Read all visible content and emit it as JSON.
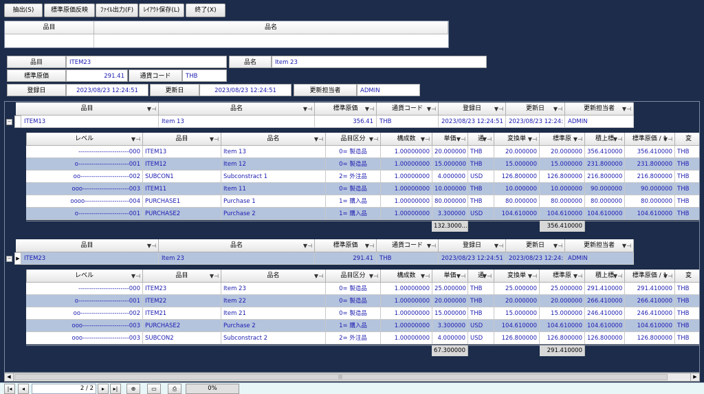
{
  "toolbar": {
    "extract": "抽出(S)",
    "std_cost_reflect": "標準原価反映",
    "file_output": "ﾌｧｲﾙ出力(F)",
    "layout_save": "ﾚｲｱｳﾄ保存(L)",
    "exit": "終了(X)"
  },
  "search": {
    "item_label": "品目",
    "name_label": "品名",
    "item_value": "",
    "name_value": ""
  },
  "info": {
    "item_label": "品目",
    "item_value": "ITEM23",
    "name_label": "品名",
    "name_value": "Item 23",
    "std_cost_label": "標準原価",
    "std_cost_value": "291.41",
    "currency_label": "通貨コード",
    "currency_value": "THB",
    "reg_date_label": "登録日",
    "reg_date_value": "2023/08/23 12:24:51",
    "upd_date_label": "更新日",
    "upd_date_value": "2023/08/23 12:24:51",
    "updater_label": "更新担当者",
    "updater_value": "ADMIN"
  },
  "parent_headers": [
    "品目",
    "品名",
    "標準原価",
    "通貨コード",
    "登録日",
    "更新日",
    "更新担当者"
  ],
  "child_headers": [
    "レベル",
    "品目",
    "品名",
    "品目区分",
    "構成数",
    "単価",
    "通",
    "変換単",
    "標準原",
    "積上標",
    "標準原価 / 1",
    "変"
  ],
  "groups": [
    {
      "parent": [
        "ITEM13",
        "Item 13",
        "356.41",
        "THB",
        "2023/08/23 12:24:51",
        "2023/08/23 12:24:",
        "ADMIN"
      ],
      "current": false,
      "rows": [
        [
          "------------------------000",
          "ITEM13",
          "Item 13",
          "0= 製造品",
          "1.00000000",
          "20.000000",
          "THB",
          "20.000000",
          "20.000000",
          "356.410000",
          "356.410000",
          "THB"
        ],
        [
          "o------------------------001",
          "ITEM12",
          "Item 12",
          "0= 製造品",
          "1.00000000",
          "15.000000",
          "THB",
          "15.000000",
          "15.000000",
          "231.800000",
          "231.800000",
          "THB"
        ],
        [
          "oo-----------------------002",
          "SUBCON1",
          "Subconstract 1",
          "2= 外注品",
          "1.00000000",
          "4.000000",
          "USD",
          "126.800000",
          "126.800000",
          "216.800000",
          "216.800000",
          "THB"
        ],
        [
          "ooo----------------------003",
          "ITEM11",
          "Item 11",
          "0= 製造品",
          "1.00000000",
          "10.000000",
          "THB",
          "10.000000",
          "10.000000",
          "90.000000",
          "90.000000",
          "THB"
        ],
        [
          "oooo---------------------004",
          "PURCHASE1",
          "Purchase 1",
          "1= 購入品",
          "1.00000000",
          "80.000000",
          "THB",
          "80.000000",
          "80.000000",
          "80.000000",
          "80.000000",
          "THB"
        ],
        [
          "o------------------------001",
          "PURCHASE2",
          "Purchase 2",
          "1= 購入品",
          "1.00000000",
          "3.300000",
          "USD",
          "104.610000",
          "104.610000",
          "104.610000",
          "104.610000",
          "THB"
        ]
      ],
      "footer_unit": "132.3000...",
      "footer_std": "356.410000"
    },
    {
      "parent": [
        "ITEM23",
        "Item 23",
        "291.41",
        "THB",
        "2023/08/23 12:24:51",
        "2023/08/23 12:24:",
        "ADMIN"
      ],
      "current": true,
      "rows": [
        [
          "------------------------000",
          "ITEM23",
          "Item 23",
          "0= 製造品",
          "1.00000000",
          "25.000000",
          "THB",
          "25.000000",
          "25.000000",
          "291.410000",
          "291.410000",
          "THB"
        ],
        [
          "o------------------------001",
          "ITEM22",
          "Item 22",
          "0= 製造品",
          "1.00000000",
          "20.000000",
          "THB",
          "20.000000",
          "20.000000",
          "266.410000",
          "266.410000",
          "THB"
        ],
        [
          "oo-----------------------002",
          "ITEM21",
          "Item 21",
          "0= 製造品",
          "1.00000000",
          "15.000000",
          "THB",
          "15.000000",
          "15.000000",
          "246.410000",
          "246.410000",
          "THB"
        ],
        [
          "ooo----------------------003",
          "PURCHASE2",
          "Purchase 2",
          "1= 購入品",
          "1.00000000",
          "3.300000",
          "USD",
          "104.610000",
          "104.610000",
          "104.610000",
          "104.610000",
          "THB"
        ],
        [
          "ooo----------------------003",
          "SUBCON2",
          "Subconstract 2",
          "2= 外注品",
          "1.00000000",
          "4.000000",
          "USD",
          "126.800000",
          "126.800000",
          "126.800000",
          "126.800000",
          "THB"
        ]
      ],
      "footer_unit": "67.300000",
      "footer_std": "291.410000"
    }
  ],
  "footer": {
    "page": "2 / 2",
    "progress": "0%",
    "progress_value": 0
  },
  "colors": {
    "background": "#1c2c4a",
    "row_alt": "#b4c4dd",
    "value_text": "#1a1ab0"
  }
}
